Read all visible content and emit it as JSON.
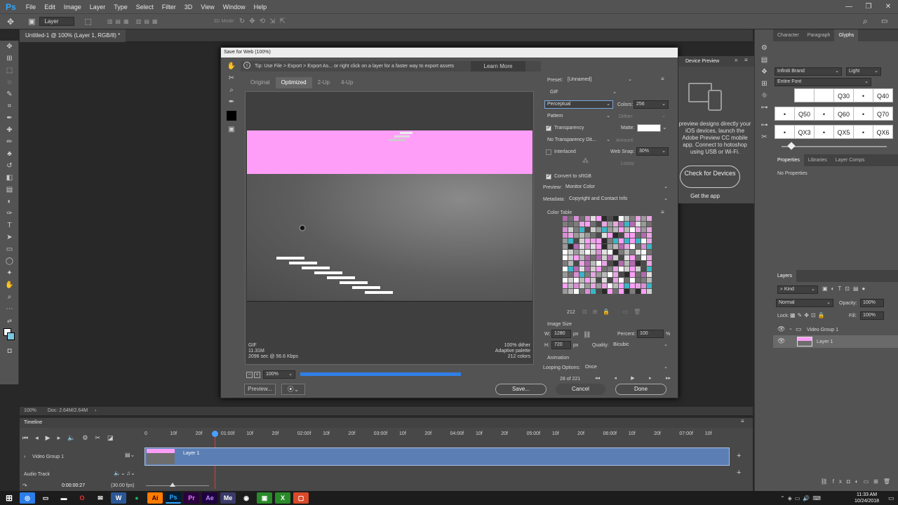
{
  "app": {
    "logo": "Ps",
    "menu": [
      "File",
      "Edit",
      "Image",
      "Layer",
      "Type",
      "Select",
      "Filter",
      "3D",
      "View",
      "Window",
      "Help"
    ],
    "window_controls": [
      "—",
      "❐",
      "✕"
    ]
  },
  "options_bar": {
    "layer_select": "Layer",
    "mode_3d": "3D Mode:"
  },
  "document": {
    "tab_title": "Untitled-1 @ 100% (Layer 1, RGB/8) *"
  },
  "status": {
    "zoom": "100%",
    "doc": "Doc: 2.64M/2.64M"
  },
  "dialog": {
    "title": "Save for Web (100%)",
    "tip": "Tip: Use File > Export > Export As...  or right click on a layer for a faster way to export assets",
    "learn_more": "Learn More",
    "view_tabs": [
      "Original",
      "Optimized",
      "2-Up",
      "4-Up"
    ],
    "active_view": "Optimized",
    "preview_info_left": [
      "GIF",
      "11.31M",
      "2096 sec @ 56.6 Kbps"
    ],
    "preview_info_right": [
      "100% dither",
      "Adaptive palette",
      "212 colors"
    ],
    "zoom": "100%",
    "preset_label": "Preset:",
    "preset": "[Unnamed]",
    "format": "GIF",
    "reduction": "Perceptual",
    "colors_label": "Colors:",
    "colors": "256",
    "dither_algo": "Pattern",
    "dither_label": "Dither:",
    "transparency_label": "Transparency",
    "transparency_checked": true,
    "matte_label": "Matte:",
    "transparency_dither": "No Transparency Dit...",
    "amount_label": "Amount:",
    "interlaced_label": "Interlaced",
    "interlaced_checked": false,
    "web_snap_label": "Web Snap:",
    "web_snap": "30%",
    "lossy_label": "Lossy:",
    "convert_srgb_label": "Convert to sRGB",
    "convert_srgb_checked": true,
    "preview_label": "Preview:",
    "preview_mode": "Monitor Color",
    "metadata_label": "Metadata:",
    "metadata": "Copyright and Contact Info",
    "color_table_label": "Color Table",
    "color_count": "212",
    "image_size_label": "Image Size",
    "w_label": "W:",
    "width": "1280",
    "h_label": "H:",
    "height": "720",
    "px": "px",
    "percent_label": "Percent:",
    "percent": "100",
    "pct": "%",
    "quality_label": "Quality:",
    "quality": "Bicubic",
    "animation_label": "Animation",
    "looping_label": "Looping Options:",
    "looping": "Once",
    "frame_counter": "28 of 221",
    "preview_btn": "Preview...",
    "save_btn": "Save...",
    "cancel_btn": "Cancel",
    "done_btn": "Done"
  },
  "device_preview": {
    "title": "Device Preview",
    "text": "preview designs directly your iOS devices, launch the Adobe Preview CC mobile app. Connect to hotoshop using USB or Wi-Fi.",
    "check_btn": "Check for Devices",
    "get_app": "Get the app"
  },
  "glyphs_panel": {
    "tabs": [
      "Character",
      "Paragraph",
      "Glyphs"
    ],
    "font": "Infiniti Brand",
    "style": "Light",
    "subset": "Entire Font",
    "cells": [
      "",
      "",
      "Q30",
      "•",
      "Q40",
      "•",
      "Q50",
      "•",
      "Q60",
      "•",
      "Q70",
      "•",
      "QX3",
      "•",
      "QX5",
      "•",
      "QX6"
    ]
  },
  "properties_panel": {
    "tabs": [
      "Properties",
      "Libraries",
      "Layer Comps"
    ],
    "text": "No Properties"
  },
  "layers_panel": {
    "title": "Layers",
    "kind": "Kind",
    "blend": "Normal",
    "opacity_label": "Opacity:",
    "opacity": "100%",
    "lock_label": "Lock:",
    "fill_label": "Fill:",
    "fill": "100%",
    "group": "Video Group 1",
    "layer": "Layer 1"
  },
  "timeline": {
    "title": "Timeline",
    "ruler": [
      "0",
      "10f",
      "20f",
      "01:00f",
      "10f",
      "20f",
      "02:00f",
      "10f",
      "20f",
      "03:00f",
      "10f",
      "20f",
      "04:00f",
      "10f",
      "20f",
      "05:00f",
      "10f",
      "20f",
      "06:00f",
      "10f",
      "20f",
      "07:00f",
      "10f"
    ],
    "track_video": "Video Group 1",
    "clip": "Layer 1",
    "track_audio": "Audio Track",
    "timecode": "0:00:00:27",
    "fps": "(30.00 fps)"
  },
  "taskbar": {
    "time": "11:33 AM",
    "date": "10/24/2018"
  },
  "colors": {
    "accent": "#2f7fe6",
    "pink": "#ff9ef8",
    "clip_blue": "#5b7fb5"
  }
}
